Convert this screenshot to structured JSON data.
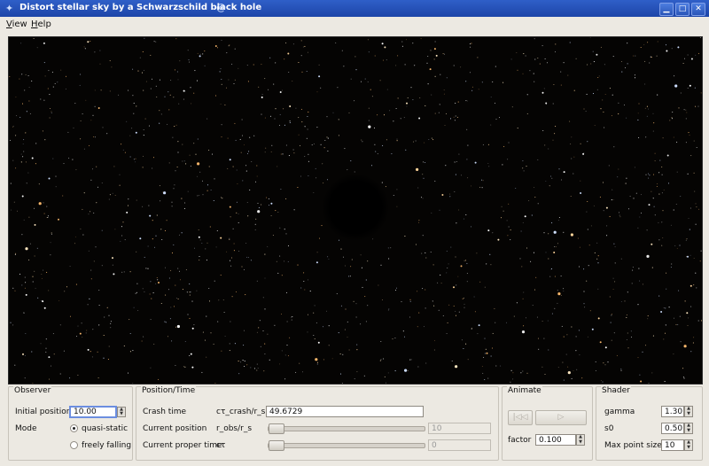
{
  "window": {
    "title": "Distort stellar sky by a Schwarzschild black hole",
    "minimize": "▁",
    "maximize": "□",
    "close": "✕"
  },
  "menu": [
    {
      "label": "View",
      "mnemonic": "V",
      "rest": "iew"
    },
    {
      "label": "Help",
      "mnemonic": "H",
      "rest": "elp"
    }
  ],
  "observer": {
    "title": "Observer",
    "initial_position_label": "Initial position",
    "initial_position_value": "10.00",
    "mode_label": "Mode",
    "mode_options": [
      "quasi-static",
      "freely falling"
    ],
    "mode_selected": "quasi-static"
  },
  "position_time": {
    "title": "Position/Time",
    "rows": [
      {
        "label": "Crash time",
        "symbol": "cτ_crash/r_s",
        "value": "49.6729"
      },
      {
        "label": "Current position",
        "symbol": "r_obs/r_s",
        "value": "10"
      },
      {
        "label": "Current proper time",
        "symbol": "cτ",
        "value": "0"
      }
    ],
    "position_slider_fraction": 0,
    "time_slider_fraction": 0
  },
  "animate": {
    "title": "Animate",
    "rewind_icon": "rewind-icon",
    "play_icon": "play-icon",
    "factor_label": "factor",
    "factor_value": "0.100"
  },
  "shader": {
    "title": "Shader",
    "gamma_label": "gamma",
    "gamma_value": "1.30",
    "s0_label": "s0",
    "s0_value": "0.50",
    "max_point_size_label": "Max point size",
    "max_point_size_value": "10"
  },
  "colors": {
    "titlebar": "#2552b8",
    "sky_background": "#050403",
    "black_hole": "#000000"
  }
}
